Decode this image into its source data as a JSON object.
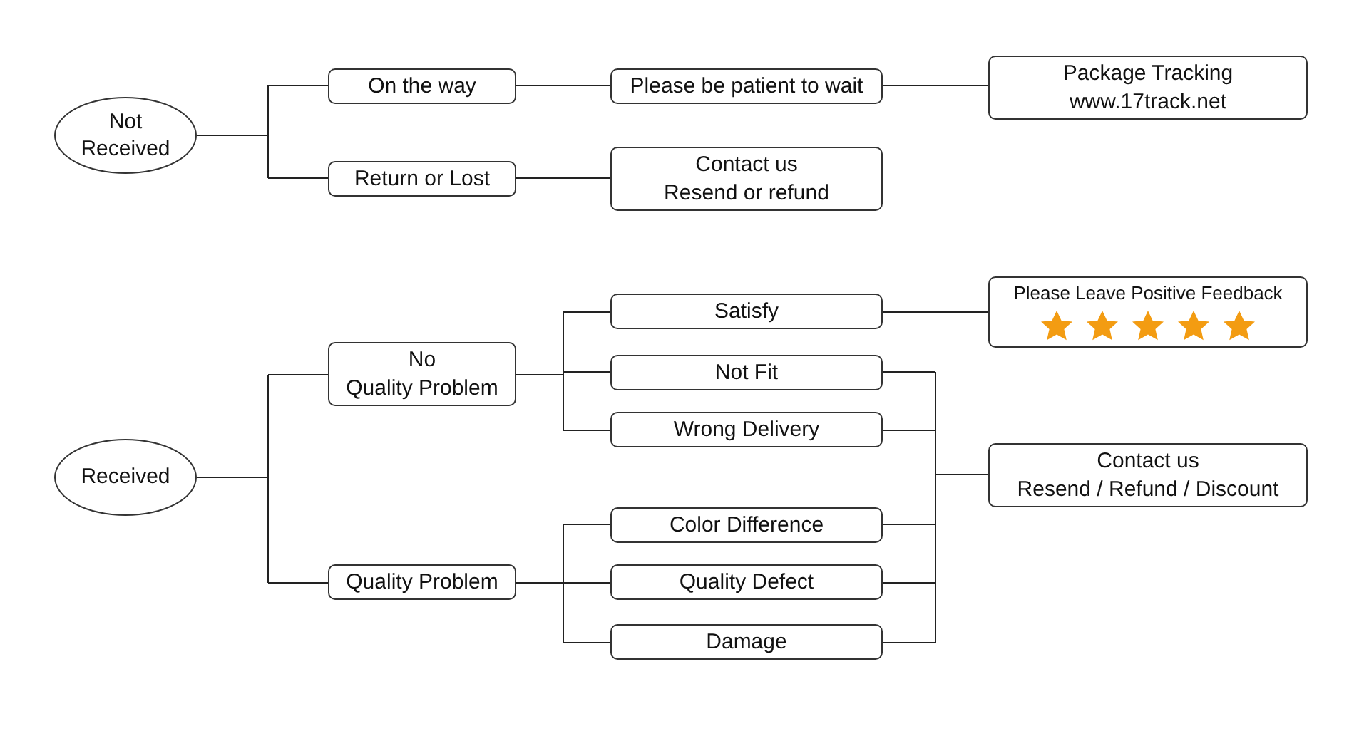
{
  "diagram": {
    "nodes": [
      {
        "kind": "ellipse",
        "lines": [
          "Not",
          "Received"
        ]
      },
      {
        "kind": "box",
        "lines": [
          "On the way"
        ]
      },
      {
        "kind": "box",
        "lines": [
          "Return or Lost"
        ]
      },
      {
        "kind": "box",
        "lines": [
          "Please be patient to wait"
        ]
      },
      {
        "kind": "box",
        "lines": [
          "Contact us",
          "Resend or refund"
        ]
      },
      {
        "kind": "box",
        "lines": [
          "Package Tracking",
          "www.17track.net"
        ]
      },
      {
        "kind": "ellipse",
        "lines": [
          "Received"
        ]
      },
      {
        "kind": "box",
        "lines": [
          "No",
          "Quality Problem"
        ]
      },
      {
        "kind": "box",
        "lines": [
          "Quality Problem"
        ]
      },
      {
        "kind": "box",
        "lines": [
          "Satisfy"
        ]
      },
      {
        "kind": "box",
        "lines": [
          "Not Fit"
        ]
      },
      {
        "kind": "box",
        "lines": [
          "Wrong Delivery"
        ]
      },
      {
        "kind": "box",
        "lines": [
          "Color Difference"
        ]
      },
      {
        "kind": "box",
        "lines": [
          "Quality Defect"
        ]
      },
      {
        "kind": "box",
        "lines": [
          "Damage"
        ]
      },
      {
        "kind": "rating",
        "lines": [
          "Please Leave Positive Feedback"
        ],
        "stars": 5
      },
      {
        "kind": "box",
        "lines": [
          "Contact us",
          "Resend / Refund / Discount"
        ]
      }
    ]
  }
}
